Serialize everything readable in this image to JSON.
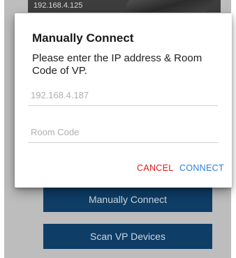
{
  "background": {
    "preview_ip": "192.168.4.125",
    "manual_connect_label": "Manually Connect",
    "scan_devices_label": "Scan VP Devices"
  },
  "dialog": {
    "title": "Manually Connect",
    "message": "Please enter the IP address & Room Code of VP.",
    "ip_placeholder": "192.168.4.187",
    "room_code_placeholder": "Room Code",
    "cancel_label": "CANCEL",
    "connect_label": "CONNECT"
  },
  "colors": {
    "button_bg": "#0e3d66",
    "cancel": "#e0191a",
    "connect": "#2f7fd4",
    "overlay": "#bdbdbd"
  }
}
